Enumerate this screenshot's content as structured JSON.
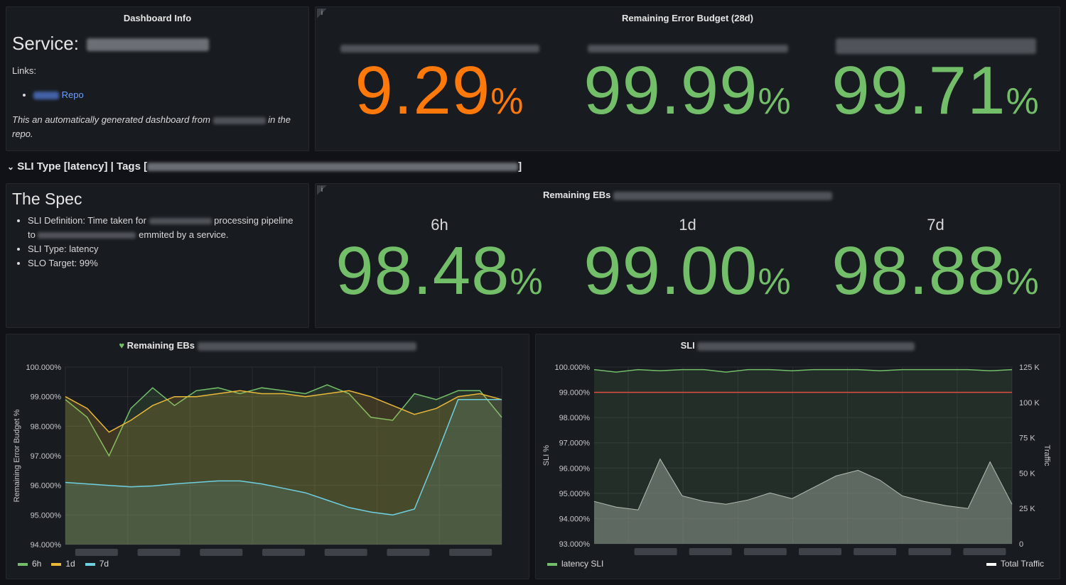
{
  "panels": {
    "dashboard_info": {
      "title": "Dashboard Info",
      "service_label": "Service:",
      "links_label": "Links:",
      "repo_link": "Repo",
      "note_a": "This an automatically generated dashboard from",
      "note_b": "in the",
      "note_c": "repo."
    },
    "remaining_error_budget": {
      "title": "Remaining Error Budget (28d)",
      "unit": "%",
      "stats": [
        {
          "value": "9.29",
          "color": "#ff780a"
        },
        {
          "value": "99.99",
          "color": "#73bf69"
        },
        {
          "value": "99.71",
          "color": "#73bf69"
        }
      ]
    },
    "row": {
      "chevron": "⌄",
      "label": "SLI Type [latency] | Tags [",
      "close": "]"
    },
    "the_spec": {
      "title": "The Spec",
      "item1_a": "SLI Definition: Time taken for",
      "item1_b": "processing pipeline",
      "item1_c": "to",
      "item1_d": "emmited by a service.",
      "item2": "SLI Type: latency",
      "item3": "SLO Target: 99%"
    },
    "remaining_ebs_stats": {
      "title": "Remaining EBs",
      "unit": "%",
      "stats": [
        {
          "period": "6h",
          "value": "98.48"
        },
        {
          "period": "1d",
          "value": "99.00"
        },
        {
          "period": "7d",
          "value": "98.88"
        }
      ]
    },
    "remaining_ebs_graph": {
      "title": "Remaining EBs",
      "heart_icon": "heart-icon",
      "ylabel": "Remaining Error Budget %",
      "legend": [
        {
          "name": "6h",
          "color": "#73bf69"
        },
        {
          "name": "1d",
          "color": "#eab839"
        },
        {
          "name": "7d",
          "color": "#6ed0e0"
        }
      ]
    },
    "sli_graph": {
      "title": "SLI",
      "ylabel_left": "SLI %",
      "ylabel_right": "Traffic",
      "legend_left": "latency SLI",
      "legend_right": "Total Traffic",
      "threshold_color": "#e24d42"
    }
  },
  "chart_data": [
    {
      "type": "line",
      "title": "Remaining EBs",
      "ylabel": "Remaining Error Budget %",
      "ylim": [
        94,
        100
      ],
      "yticks": [
        "100.000%",
        "99.000%",
        "98.000%",
        "97.000%",
        "96.000%",
        "95.000%",
        "94.000%"
      ],
      "x_count": 7,
      "series": [
        {
          "name": "6h",
          "color": "#73bf69",
          "values": [
            98.9,
            98.3,
            97.0,
            98.6,
            99.3,
            98.7,
            99.2,
            99.3,
            99.1,
            99.3,
            99.2,
            99.1,
            99.4,
            99.1,
            98.3,
            98.2,
            99.1,
            98.9,
            99.2,
            99.2,
            98.3
          ]
        },
        {
          "name": "1d",
          "color": "#eab839",
          "values": [
            99.0,
            98.6,
            97.8,
            98.2,
            98.7,
            99.0,
            99.0,
            99.1,
            99.2,
            99.1,
            99.1,
            99.0,
            99.1,
            99.2,
            99.0,
            98.7,
            98.4,
            98.6,
            99.0,
            99.1,
            98.9
          ]
        },
        {
          "name": "7d",
          "color": "#6ed0e0",
          "values": [
            96.1,
            96.05,
            96.0,
            95.95,
            95.98,
            96.05,
            96.1,
            96.15,
            96.15,
            96.05,
            95.9,
            95.75,
            95.5,
            95.25,
            95.1,
            95.0,
            95.2,
            97.0,
            98.9,
            98.9,
            98.9
          ]
        }
      ]
    },
    {
      "type": "line",
      "title": "SLI",
      "ylabel": "SLI %",
      "ylim": [
        93,
        100
      ],
      "yticks": [
        "100.000%",
        "99.000%",
        "98.000%",
        "97.000%",
        "96.000%",
        "95.000%",
        "94.000%",
        "93.000%"
      ],
      "y2label": "Traffic",
      "y2ticks": [
        "125 K",
        "100 K",
        "75 K",
        "50 K",
        "25 K",
        "0"
      ],
      "threshold": 99,
      "series": [
        {
          "name": "latency SLI",
          "color": "#73bf69",
          "values": [
            99.9,
            99.8,
            99.9,
            99.85,
            99.9,
            99.9,
            99.8,
            99.9,
            99.9,
            99.85,
            99.9,
            99.9,
            99.9,
            99.85,
            99.9,
            99.9,
            99.9,
            99.9,
            99.85,
            99.9
          ]
        },
        {
          "name": "Total Traffic",
          "color": "#ffffff",
          "values": [
            30000,
            26000,
            24000,
            60000,
            34000,
            30000,
            28000,
            31000,
            36000,
            32000,
            40000,
            48000,
            52000,
            45000,
            34000,
            30000,
            27000,
            25000,
            58000,
            28000
          ]
        }
      ]
    }
  ]
}
